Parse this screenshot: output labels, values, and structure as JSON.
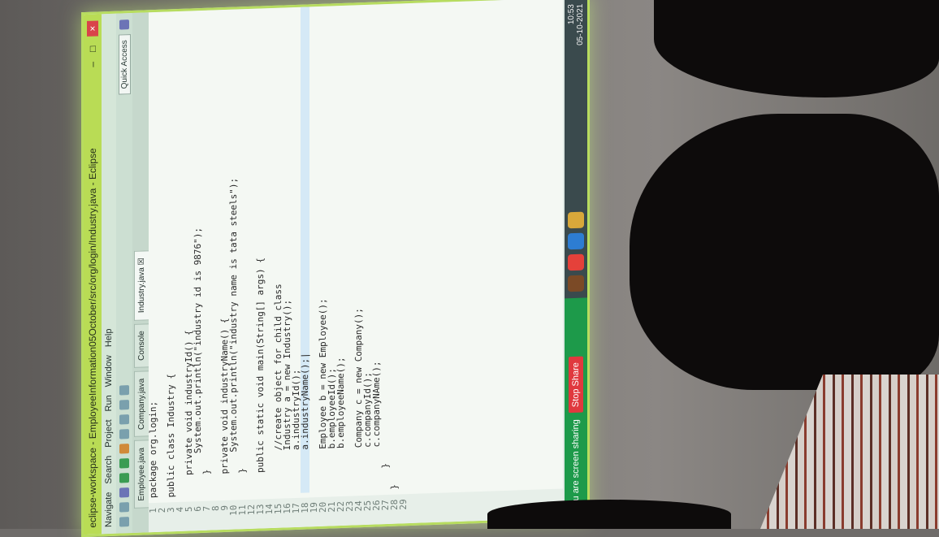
{
  "title": "eclipse-workspace - EmployeeInformation05October/src/org/login/Industry.java - Eclipse",
  "window_controls": [
    "–",
    "□",
    "×"
  ],
  "menu": [
    "Navigate",
    "Search",
    "Project",
    "Run",
    "Window",
    "Help"
  ],
  "quick_access": "Quick Access",
  "tabs": [
    "Employee.java",
    "Company.java",
    "Console",
    "Industry.java ☒"
  ],
  "gutter": [
    "1",
    "2",
    "3",
    "4",
    "5",
    "6",
    "7",
    "8",
    "9",
    "10",
    "11",
    "12",
    "13",
    "14",
    "15",
    "16",
    "17",
    "18",
    "19",
    "20",
    "21",
    "22",
    "23",
    "24",
    "25",
    "26",
    "27",
    "28",
    "29"
  ],
  "code_lines": [
    "package org.login;",
    "",
    "public class Industry {",
    "",
    "    private void industryId() {",
    "        System.out.println(\"industry id is 9876\");",
    "    }",
    "",
    "    private void industryName() {",
    "        System.out.println(\"industry name is tata steels\");",
    "    }",
    "",
    "    public static void main(String[] args) {",
    "",
    "        //create object for child class",
    "        Industry a = new Industry();",
    "        a.industryId();",
    "        a.industryName();|",
    "",
    "        Employee b = new Employee();",
    "        b.employeeId();",
    "        b.employeeName();",
    "",
    "        Company c = new Company();",
    "        c.companyId();",
    "        c.companyNAme();",
    "    }",
    "}",
    ""
  ],
  "share_bar": {
    "message": "You are screen sharing",
    "stop": "Stop Share"
  },
  "clock": {
    "time": "10:53",
    "date": "05-10-2021"
  }
}
